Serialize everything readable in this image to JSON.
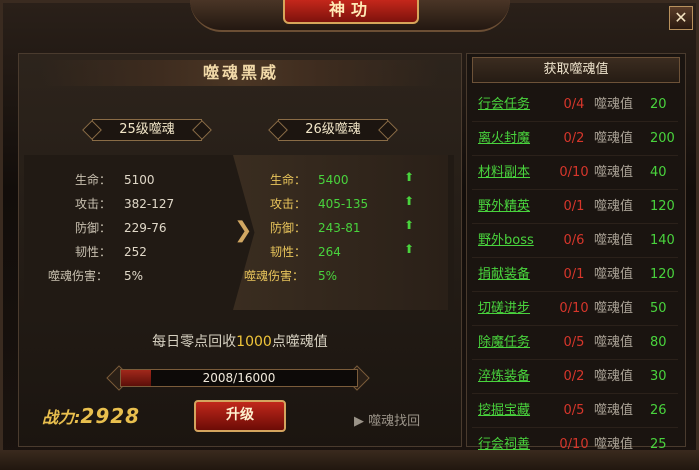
{
  "window": {
    "title": "神功",
    "close_label": "✕"
  },
  "left": {
    "title": "噬魂黑威",
    "current_level": "25级噬魂",
    "next_level": "26级噬魂",
    "current_stats": [
      {
        "label": "生命：",
        "value": "5100"
      },
      {
        "label": "攻击：",
        "value": "382-127"
      },
      {
        "label": "防御：",
        "value": "229-76"
      },
      {
        "label": "韧性：",
        "value": "252"
      },
      {
        "label": "噬魂伤害：",
        "value": "5%"
      }
    ],
    "next_stats": [
      {
        "label": "生命：",
        "value": "5400"
      },
      {
        "label": "攻击：",
        "value": "405-135"
      },
      {
        "label": "防御：",
        "value": "243-81"
      },
      {
        "label": "韧性：",
        "value": "264"
      },
      {
        "label": "噬魂伤害：",
        "value": "5%"
      }
    ],
    "recycle_prefix": "每日零点回收",
    "recycle_amount": "1000",
    "recycle_suffix": "点噬魂值",
    "progress_text": "2008/16000",
    "progress_fraction": 0.1255,
    "power_label": "战力:",
    "power_value": "2928",
    "upgrade_label": "升级",
    "recover_label": "▶ 噬魂找回"
  },
  "right": {
    "title": "获取噬魂值",
    "value_label": "噬魂值",
    "rows": [
      {
        "task": "行会任务",
        "count": "0/4",
        "value": "20"
      },
      {
        "task": "离火封魔",
        "count": "0/2",
        "value": "200"
      },
      {
        "task": "材料副本",
        "count": "0/10",
        "value": "40"
      },
      {
        "task": "野外精英",
        "count": "0/1",
        "value": "120"
      },
      {
        "task": "野外boss",
        "count": "0/6",
        "value": "140"
      },
      {
        "task": "捐献装备",
        "count": "0/1",
        "value": "120"
      },
      {
        "task": "切磋进步",
        "count": "0/10",
        "value": "50"
      },
      {
        "task": "除魔任务",
        "count": "0/5",
        "value": "80"
      },
      {
        "task": "淬炼装备",
        "count": "0/2",
        "value": "30"
      },
      {
        "task": "挖掘宝藏",
        "count": "0/5",
        "value": "26"
      },
      {
        "task": "行会祠善",
        "count": "0/10",
        "value": "25"
      }
    ]
  },
  "colors": {
    "accent_green": "#49d33d",
    "accent_red": "#d6362b",
    "gold": "#f0c53a"
  }
}
